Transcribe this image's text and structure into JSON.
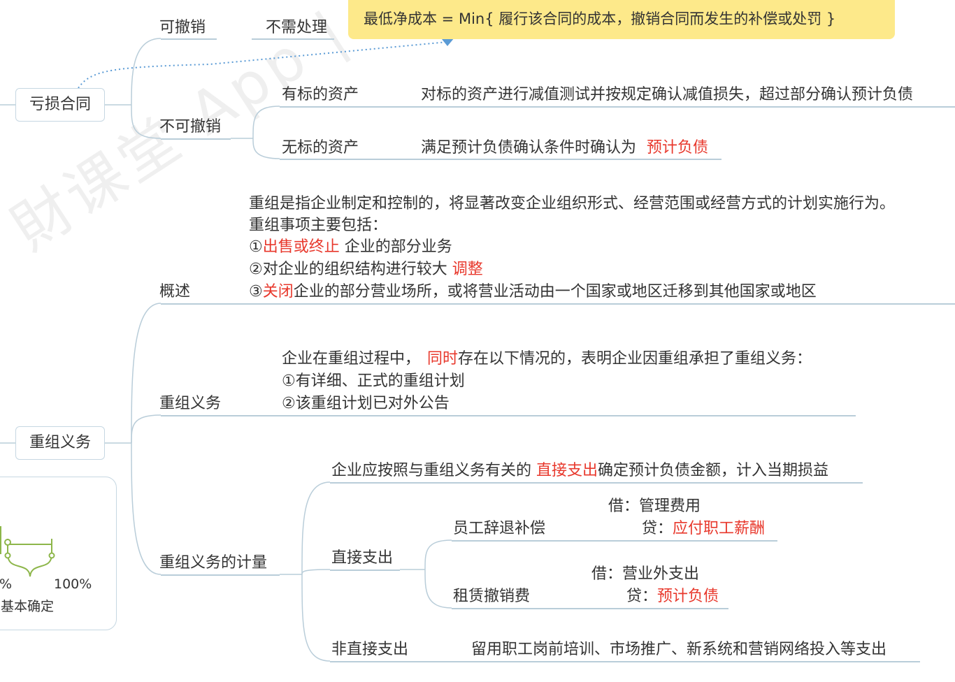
{
  "watermark": "財课堂 App | 会计免费视频",
  "note": {
    "text": "最低净成本 = Min{ 履行该合同的成本，撤销合同而发生的补偿或处罚 }"
  },
  "loss_contract": {
    "label": "亏损合同",
    "revocable": {
      "label": "可撤销",
      "result": "不需处理"
    },
    "irrevocable": {
      "label": "不可撤销",
      "with_asset": {
        "label": "有标的资产",
        "result": "对标的资产进行减值测试并按规定确认减值损失，超过部分确认预计负债"
      },
      "without_asset": {
        "label": "无标的资产",
        "result_prefix": "满足预计负债确认条件时确认为",
        "result_highlight": "预计负债"
      }
    }
  },
  "restructuring": {
    "label": "重组义务",
    "overview": {
      "label": "概述",
      "line1": "重组是指企业制定和控制的，将显著改变企业组织形式、经营范围或经营方式的计划实施行为。",
      "line2": "重组事项主要包括：",
      "item1_prefix": "①",
      "item1_red": "出售或终止",
      "item1_rest": " 企业的部分业务",
      "item2_prefix": "②对企业的组织结构进行较大 ",
      "item2_red": "调整",
      "item3_prefix": "③",
      "item3_red": "关闭",
      "item3_rest": "企业的部分营业场所，或将营业活动由一个国家或地区迁移到其他国家或地区"
    },
    "obligation": {
      "label": "重组义务",
      "line1_prefix": "企业在重组过程中，",
      "line1_red": "同时",
      "line1_rest": "存在以下情况的，表明企业因重组承担了重组义务：",
      "line2": "①有详细、正式的重组计划",
      "line3": "②该重组计划已对外公告"
    },
    "measurement": {
      "label": "重组义务的计量",
      "summary_prefix": "企业应按照与重组义务有关的 ",
      "summary_red": "直接支出",
      "summary_rest": "确定预计负债金额，计入当期损益",
      "direct": {
        "label": "直接支出",
        "severance": {
          "label": "员工辞退补偿",
          "debit": "借：管理费用",
          "credit_prefix": "贷：",
          "credit_red": "应付职工薪酬"
        },
        "lease": {
          "label": "租赁撤销费",
          "debit": "借：营业外支出",
          "credit_prefix": "贷：",
          "credit_red": "预计负债"
        }
      },
      "indirect": {
        "label": "非直接支出",
        "text": "留用职工岗前培训、市场推广、新系统和营销网络投入等支出"
      }
    }
  },
  "side_panel": {
    "percent_left": "%",
    "percent_right": "100%",
    "caption": "基本确定"
  }
}
